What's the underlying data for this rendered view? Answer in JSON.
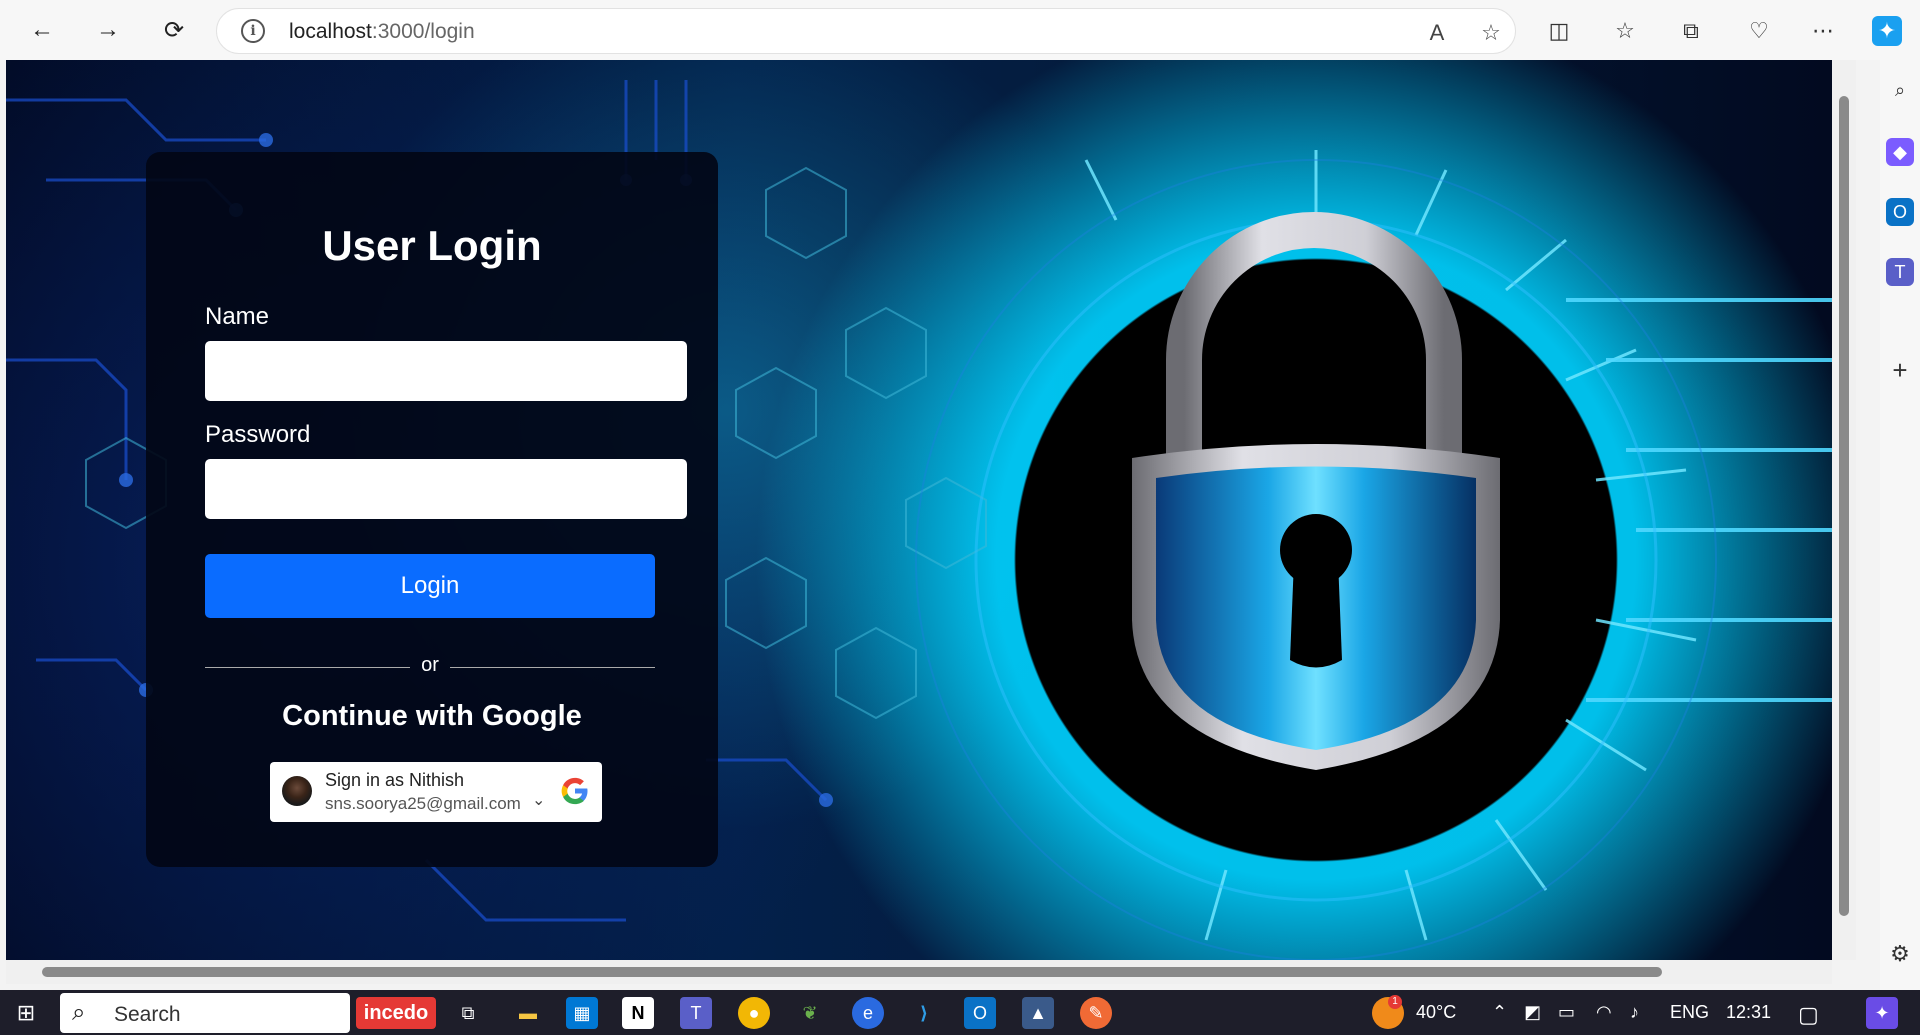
{
  "browser": {
    "url_host": "localhost",
    "url_path": ":3000/login",
    "info_icon": "info-icon"
  },
  "login": {
    "title": "User Login",
    "name_label": "Name",
    "name_value": "",
    "password_label": "Password",
    "password_value": "",
    "button_label": "Login",
    "divider_text": "or",
    "google_title": "Continue with Google",
    "google_account_name": "Sign in as Nithish",
    "google_account_email": "sns.soorya25@gmail.com"
  },
  "taskbar": {
    "search_label": "Search",
    "brand_label": "incedo",
    "temperature": "40°C",
    "language": "ENG",
    "time": "12:31",
    "notification_badge": "1"
  },
  "colors": {
    "accent": "#0a6cff",
    "card_bg": "#020616",
    "taskbar_bg": "#1e1e2a"
  }
}
